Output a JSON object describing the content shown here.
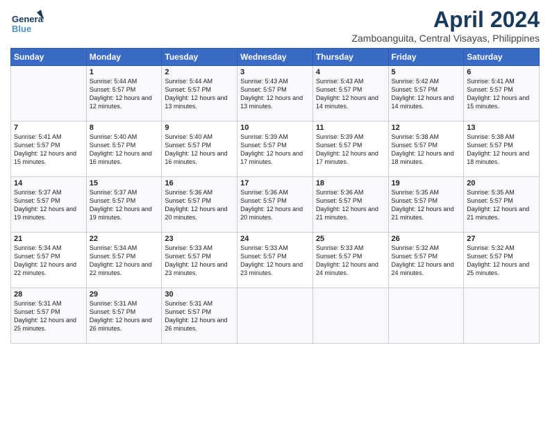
{
  "header": {
    "logo_general": "General",
    "logo_blue": "Blue",
    "month_year": "April 2024",
    "location": "Zamboanguita, Central Visayas, Philippines"
  },
  "columns": [
    "Sunday",
    "Monday",
    "Tuesday",
    "Wednesday",
    "Thursday",
    "Friday",
    "Saturday"
  ],
  "weeks": [
    [
      {
        "day": "",
        "sunrise": "",
        "sunset": "",
        "daylight": ""
      },
      {
        "day": "1",
        "sunrise": "Sunrise: 5:44 AM",
        "sunset": "Sunset: 5:57 PM",
        "daylight": "Daylight: 12 hours and 12 minutes."
      },
      {
        "day": "2",
        "sunrise": "Sunrise: 5:44 AM",
        "sunset": "Sunset: 5:57 PM",
        "daylight": "Daylight: 12 hours and 13 minutes."
      },
      {
        "day": "3",
        "sunrise": "Sunrise: 5:43 AM",
        "sunset": "Sunset: 5:57 PM",
        "daylight": "Daylight: 12 hours and 13 minutes."
      },
      {
        "day": "4",
        "sunrise": "Sunrise: 5:43 AM",
        "sunset": "Sunset: 5:57 PM",
        "daylight": "Daylight: 12 hours and 14 minutes."
      },
      {
        "day": "5",
        "sunrise": "Sunrise: 5:42 AM",
        "sunset": "Sunset: 5:57 PM",
        "daylight": "Daylight: 12 hours and 14 minutes."
      },
      {
        "day": "6",
        "sunrise": "Sunrise: 5:41 AM",
        "sunset": "Sunset: 5:57 PM",
        "daylight": "Daylight: 12 hours and 15 minutes."
      }
    ],
    [
      {
        "day": "7",
        "sunrise": "Sunrise: 5:41 AM",
        "sunset": "Sunset: 5:57 PM",
        "daylight": "Daylight: 12 hours and 15 minutes."
      },
      {
        "day": "8",
        "sunrise": "Sunrise: 5:40 AM",
        "sunset": "Sunset: 5:57 PM",
        "daylight": "Daylight: 12 hours and 16 minutes."
      },
      {
        "day": "9",
        "sunrise": "Sunrise: 5:40 AM",
        "sunset": "Sunset: 5:57 PM",
        "daylight": "Daylight: 12 hours and 16 minutes."
      },
      {
        "day": "10",
        "sunrise": "Sunrise: 5:39 AM",
        "sunset": "Sunset: 5:57 PM",
        "daylight": "Daylight: 12 hours and 17 minutes."
      },
      {
        "day": "11",
        "sunrise": "Sunrise: 5:39 AM",
        "sunset": "Sunset: 5:57 PM",
        "daylight": "Daylight: 12 hours and 17 minutes."
      },
      {
        "day": "12",
        "sunrise": "Sunrise: 5:38 AM",
        "sunset": "Sunset: 5:57 PM",
        "daylight": "Daylight: 12 hours and 18 minutes."
      },
      {
        "day": "13",
        "sunrise": "Sunrise: 5:38 AM",
        "sunset": "Sunset: 5:57 PM",
        "daylight": "Daylight: 12 hours and 18 minutes."
      }
    ],
    [
      {
        "day": "14",
        "sunrise": "Sunrise: 5:37 AM",
        "sunset": "Sunset: 5:57 PM",
        "daylight": "Daylight: 12 hours and 19 minutes."
      },
      {
        "day": "15",
        "sunrise": "Sunrise: 5:37 AM",
        "sunset": "Sunset: 5:57 PM",
        "daylight": "Daylight: 12 hours and 19 minutes."
      },
      {
        "day": "16",
        "sunrise": "Sunrise: 5:36 AM",
        "sunset": "Sunset: 5:57 PM",
        "daylight": "Daylight: 12 hours and 20 minutes."
      },
      {
        "day": "17",
        "sunrise": "Sunrise: 5:36 AM",
        "sunset": "Sunset: 5:57 PM",
        "daylight": "Daylight: 12 hours and 20 minutes."
      },
      {
        "day": "18",
        "sunrise": "Sunrise: 5:36 AM",
        "sunset": "Sunset: 5:57 PM",
        "daylight": "Daylight: 12 hours and 21 minutes."
      },
      {
        "day": "19",
        "sunrise": "Sunrise: 5:35 AM",
        "sunset": "Sunset: 5:57 PM",
        "daylight": "Daylight: 12 hours and 21 minutes."
      },
      {
        "day": "20",
        "sunrise": "Sunrise: 5:35 AM",
        "sunset": "Sunset: 5:57 PM",
        "daylight": "Daylight: 12 hours and 21 minutes."
      }
    ],
    [
      {
        "day": "21",
        "sunrise": "Sunrise: 5:34 AM",
        "sunset": "Sunset: 5:57 PM",
        "daylight": "Daylight: 12 hours and 22 minutes."
      },
      {
        "day": "22",
        "sunrise": "Sunrise: 5:34 AM",
        "sunset": "Sunset: 5:57 PM",
        "daylight": "Daylight: 12 hours and 22 minutes."
      },
      {
        "day": "23",
        "sunrise": "Sunrise: 5:33 AM",
        "sunset": "Sunset: 5:57 PM",
        "daylight": "Daylight: 12 hours and 23 minutes."
      },
      {
        "day": "24",
        "sunrise": "Sunrise: 5:33 AM",
        "sunset": "Sunset: 5:57 PM",
        "daylight": "Daylight: 12 hours and 23 minutes."
      },
      {
        "day": "25",
        "sunrise": "Sunrise: 5:33 AM",
        "sunset": "Sunset: 5:57 PM",
        "daylight": "Daylight: 12 hours and 24 minutes."
      },
      {
        "day": "26",
        "sunrise": "Sunrise: 5:32 AM",
        "sunset": "Sunset: 5:57 PM",
        "daylight": "Daylight: 12 hours and 24 minutes."
      },
      {
        "day": "27",
        "sunrise": "Sunrise: 5:32 AM",
        "sunset": "Sunset: 5:57 PM",
        "daylight": "Daylight: 12 hours and 25 minutes."
      }
    ],
    [
      {
        "day": "28",
        "sunrise": "Sunrise: 5:31 AM",
        "sunset": "Sunset: 5:57 PM",
        "daylight": "Daylight: 12 hours and 25 minutes."
      },
      {
        "day": "29",
        "sunrise": "Sunrise: 5:31 AM",
        "sunset": "Sunset: 5:57 PM",
        "daylight": "Daylight: 12 hours and 26 minutes."
      },
      {
        "day": "30",
        "sunrise": "Sunrise: 5:31 AM",
        "sunset": "Sunset: 5:57 PM",
        "daylight": "Daylight: 12 hours and 26 minutes."
      },
      {
        "day": "",
        "sunrise": "",
        "sunset": "",
        "daylight": ""
      },
      {
        "day": "",
        "sunrise": "",
        "sunset": "",
        "daylight": ""
      },
      {
        "day": "",
        "sunrise": "",
        "sunset": "",
        "daylight": ""
      },
      {
        "day": "",
        "sunrise": "",
        "sunset": "",
        "daylight": ""
      }
    ]
  ]
}
